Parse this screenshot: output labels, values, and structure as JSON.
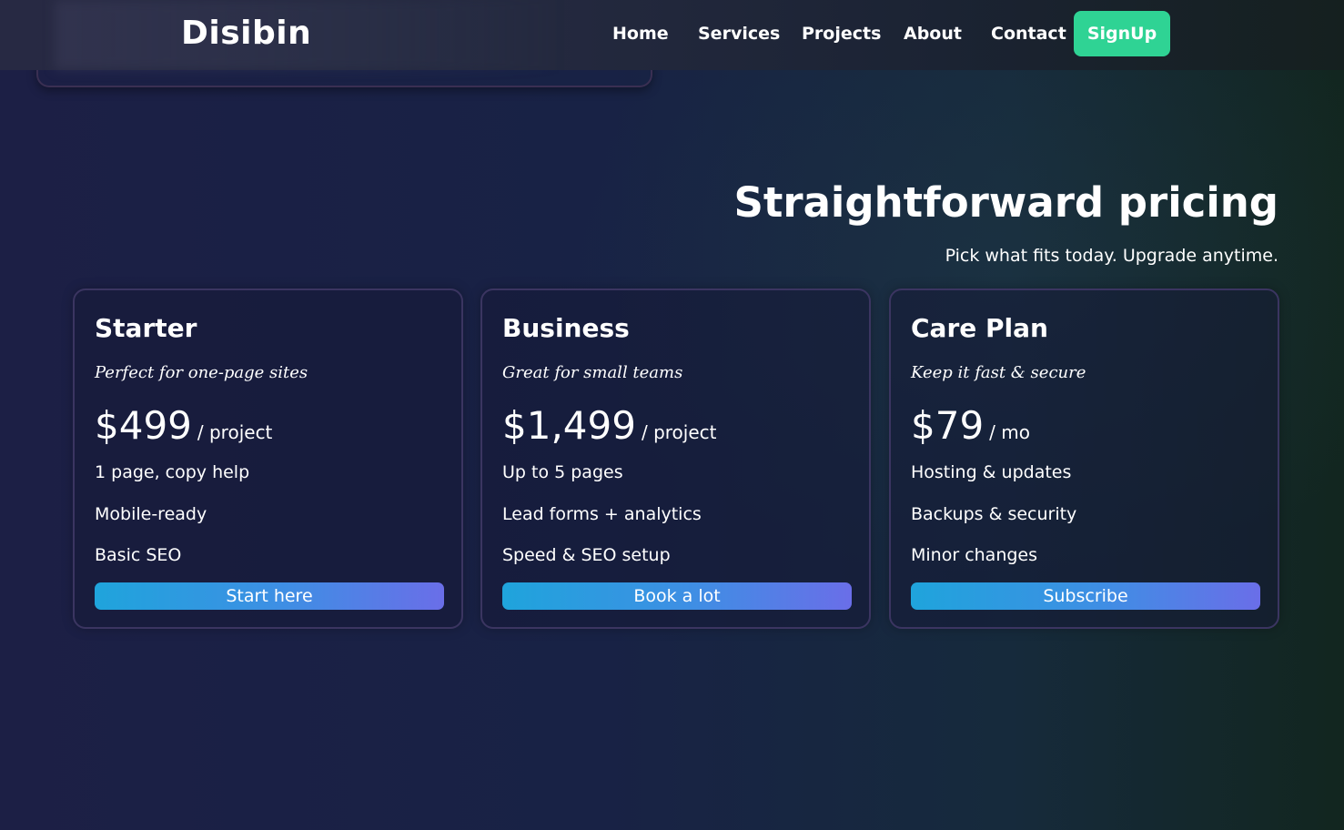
{
  "header": {
    "logo": "Disibin",
    "nav": [
      "Home",
      "Services",
      "Projects",
      "About",
      "Contact"
    ],
    "signup_label": "SignUp"
  },
  "pricing": {
    "title": "Straightforward pricing",
    "subtitle": "Pick what fits today. Upgrade anytime.",
    "plans": [
      {
        "name": "Starter",
        "tagline": "Perfect for one-page sites",
        "price": "$499",
        "unit": "/ project",
        "features": [
          "1 page, copy help",
          "Mobile-ready",
          "Basic SEO"
        ],
        "button": "Start here"
      },
      {
        "name": "Business",
        "tagline": "Great for small teams",
        "price": "$1,499",
        "unit": "/ project",
        "features": [
          "Up to 5 pages",
          "Lead forms + analytics",
          "Speed & SEO setup"
        ],
        "button": "Book a lot"
      },
      {
        "name": "Care Plan",
        "tagline": "Keep it fast & secure",
        "price": "$79",
        "unit": "/ mo",
        "features": [
          "Hosting & updates",
          "Backups & security",
          "Minor changes"
        ],
        "button": "Subscribe"
      }
    ]
  },
  "colors": {
    "accent_green": "#2fd394",
    "button_gradient_start": "#1fa4dc",
    "button_gradient_end": "#6a6ee8",
    "card_border": "#3b3561"
  }
}
